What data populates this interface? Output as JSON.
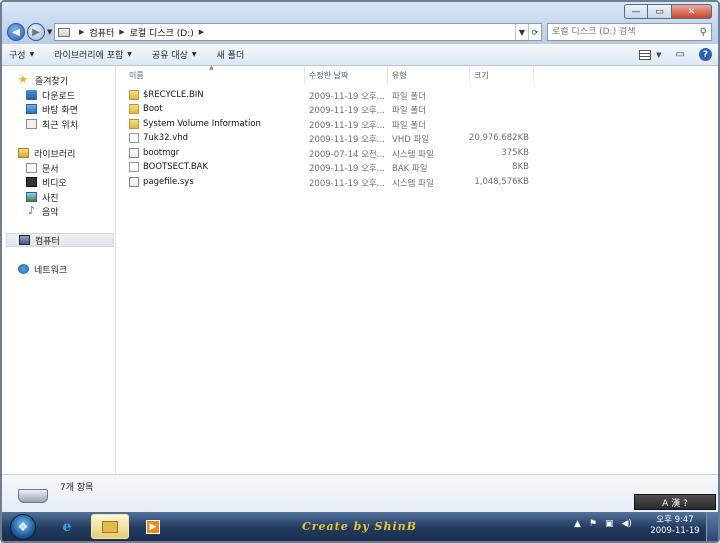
{
  "window": {
    "controls": {
      "minimize": "—",
      "maximize": "▭",
      "close": "✕"
    }
  },
  "address": {
    "crumbs": [
      "컴퓨터",
      "로컬 디스크 (D:)"
    ],
    "search_placeholder": "로컬 디스크 (D:) 검색"
  },
  "commands": [
    "구성",
    "라이브러리에 포함",
    "공유 대상",
    "새 폴더"
  ],
  "nav": {
    "favorites": {
      "label": "즐겨찾기",
      "items": [
        "다운로드",
        "바탕 화면",
        "최근 위치"
      ]
    },
    "libraries": {
      "label": "라이브러리",
      "items": [
        "문서",
        "비디오",
        "사진",
        "음악"
      ]
    },
    "computer": "컴퓨터",
    "network": "네트워크"
  },
  "columns": {
    "name": "이름",
    "date": "수정한 날짜",
    "type": "유형",
    "size": "크기"
  },
  "files": [
    {
      "name": "$RECYCLE.BIN",
      "date": "2009-11-19 오후...",
      "type": "파일 폴더",
      "size": "",
      "icon": "folder-icon"
    },
    {
      "name": "Boot",
      "date": "2009-11-19 오후...",
      "type": "파일 폴더",
      "size": "",
      "icon": "folder-icon"
    },
    {
      "name": "System Volume Information",
      "date": "2009-11-19 오후...",
      "type": "파일 폴더",
      "size": "",
      "icon": "locked-folder-icon"
    },
    {
      "name": "7uk32.vhd",
      "date": "2009-11-19 오후...",
      "type": "VHD 파일",
      "size": "20,976,682KB",
      "icon": "file-icon"
    },
    {
      "name": "bootmgr",
      "date": "2009-07-14 오전...",
      "type": "시스템 파일",
      "size": "375KB",
      "icon": "system-file-icon"
    },
    {
      "name": "BOOTSECT.BAK",
      "date": "2009-11-19 오후...",
      "type": "BAK 파일",
      "size": "8KB",
      "icon": "file-icon"
    },
    {
      "name": "pagefile.sys",
      "date": "2009-11-19 오후...",
      "type": "시스템 파일",
      "size": "1,048,576KB",
      "icon": "system-file-icon"
    }
  ],
  "details": {
    "item_count": "7개 항목"
  },
  "taskbar": {
    "watermark": "Create by ShinB",
    "clock_time": "오후 9:47",
    "clock_date": "2009-11-19",
    "langbar": "A 漢 ?"
  }
}
